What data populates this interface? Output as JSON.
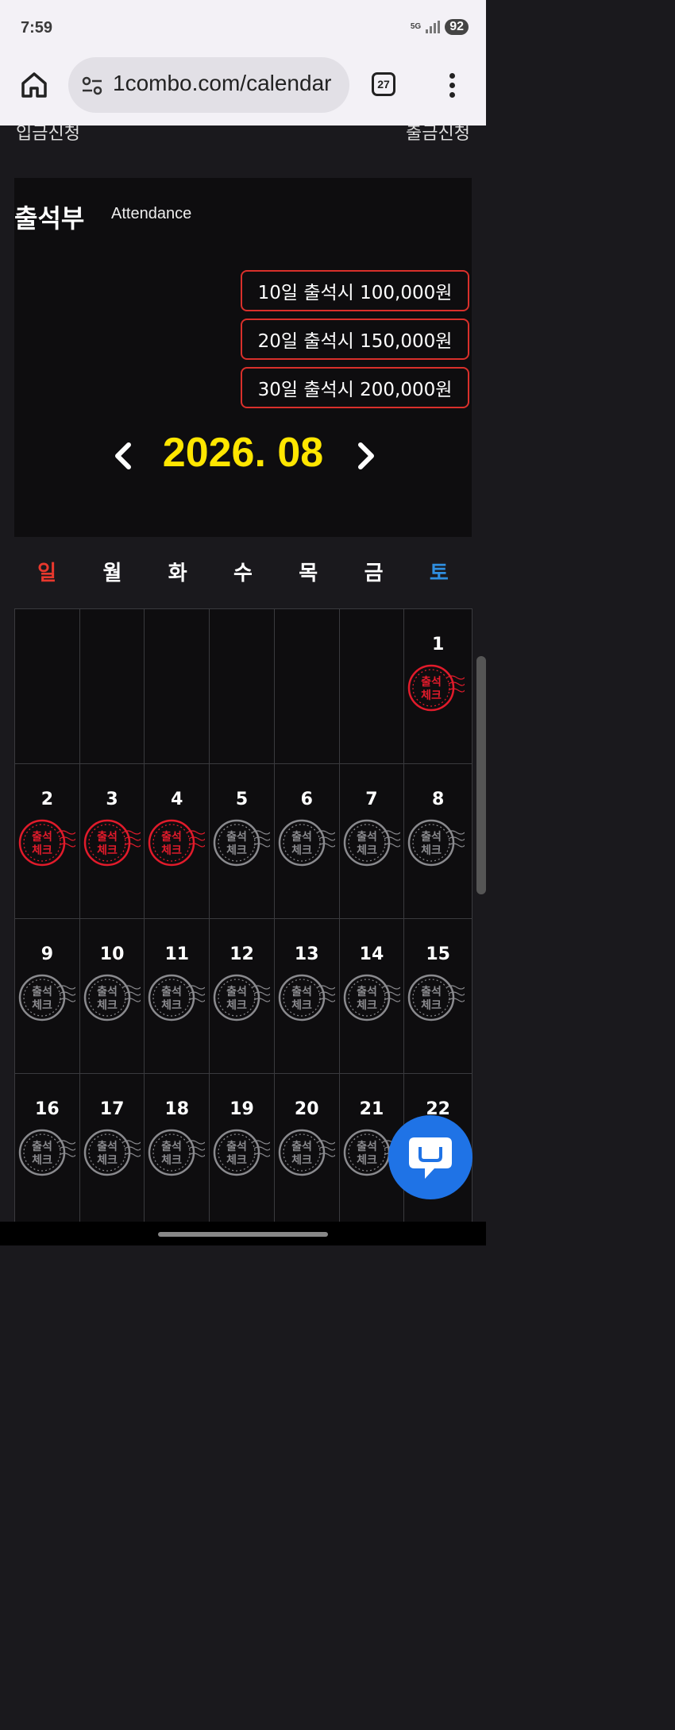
{
  "status_bar": {
    "time": "7:59",
    "network": "5G",
    "battery": "92"
  },
  "browser": {
    "url": "1combo.com/calendar",
    "tab_count": "27"
  },
  "top_links": {
    "deposit": "입금신청",
    "withdraw": "출금신청"
  },
  "attendance": {
    "title": "출석부",
    "subtitle": "Attendance",
    "rewards": [
      "10일 출석시 100,000원",
      "20일 출석시 150,000원",
      "30일 출석시 200,000원"
    ],
    "month": "2026. 08"
  },
  "weekdays": [
    "일",
    "월",
    "화",
    "수",
    "목",
    "금",
    "토"
  ],
  "stamp_text": {
    "line1": "출석",
    "line2": "체크"
  },
  "calendar": {
    "weeks": [
      [
        {
          "day": ""
        },
        {
          "day": ""
        },
        {
          "day": ""
        },
        {
          "day": ""
        },
        {
          "day": ""
        },
        {
          "day": ""
        },
        {
          "day": "1",
          "checked": true
        }
      ],
      [
        {
          "day": "2",
          "checked": true
        },
        {
          "day": "3",
          "checked": true
        },
        {
          "day": "4",
          "checked": true
        },
        {
          "day": "5",
          "checked": false
        },
        {
          "day": "6",
          "checked": false
        },
        {
          "day": "7",
          "checked": false
        },
        {
          "day": "8",
          "checked": false
        }
      ],
      [
        {
          "day": "9",
          "checked": false
        },
        {
          "day": "10",
          "checked": false
        },
        {
          "day": "11",
          "checked": false
        },
        {
          "day": "12",
          "checked": false
        },
        {
          "day": "13",
          "checked": false
        },
        {
          "day": "14",
          "checked": false
        },
        {
          "day": "15",
          "checked": false
        }
      ],
      [
        {
          "day": "16",
          "checked": false
        },
        {
          "day": "17",
          "checked": false
        },
        {
          "day": "18",
          "checked": false
        },
        {
          "day": "19",
          "checked": false
        },
        {
          "day": "20",
          "checked": false
        },
        {
          "day": "21",
          "checked": false
        },
        {
          "day": "22",
          "checked": false
        }
      ]
    ]
  },
  "colors": {
    "accent_yellow": "#ffe600",
    "stamp_red": "#e21b2b",
    "stamp_gray": "#8a8a8e",
    "sunday": "#e8382d",
    "saturday": "#2f8fe0",
    "chat_blue": "#1f73e6"
  }
}
